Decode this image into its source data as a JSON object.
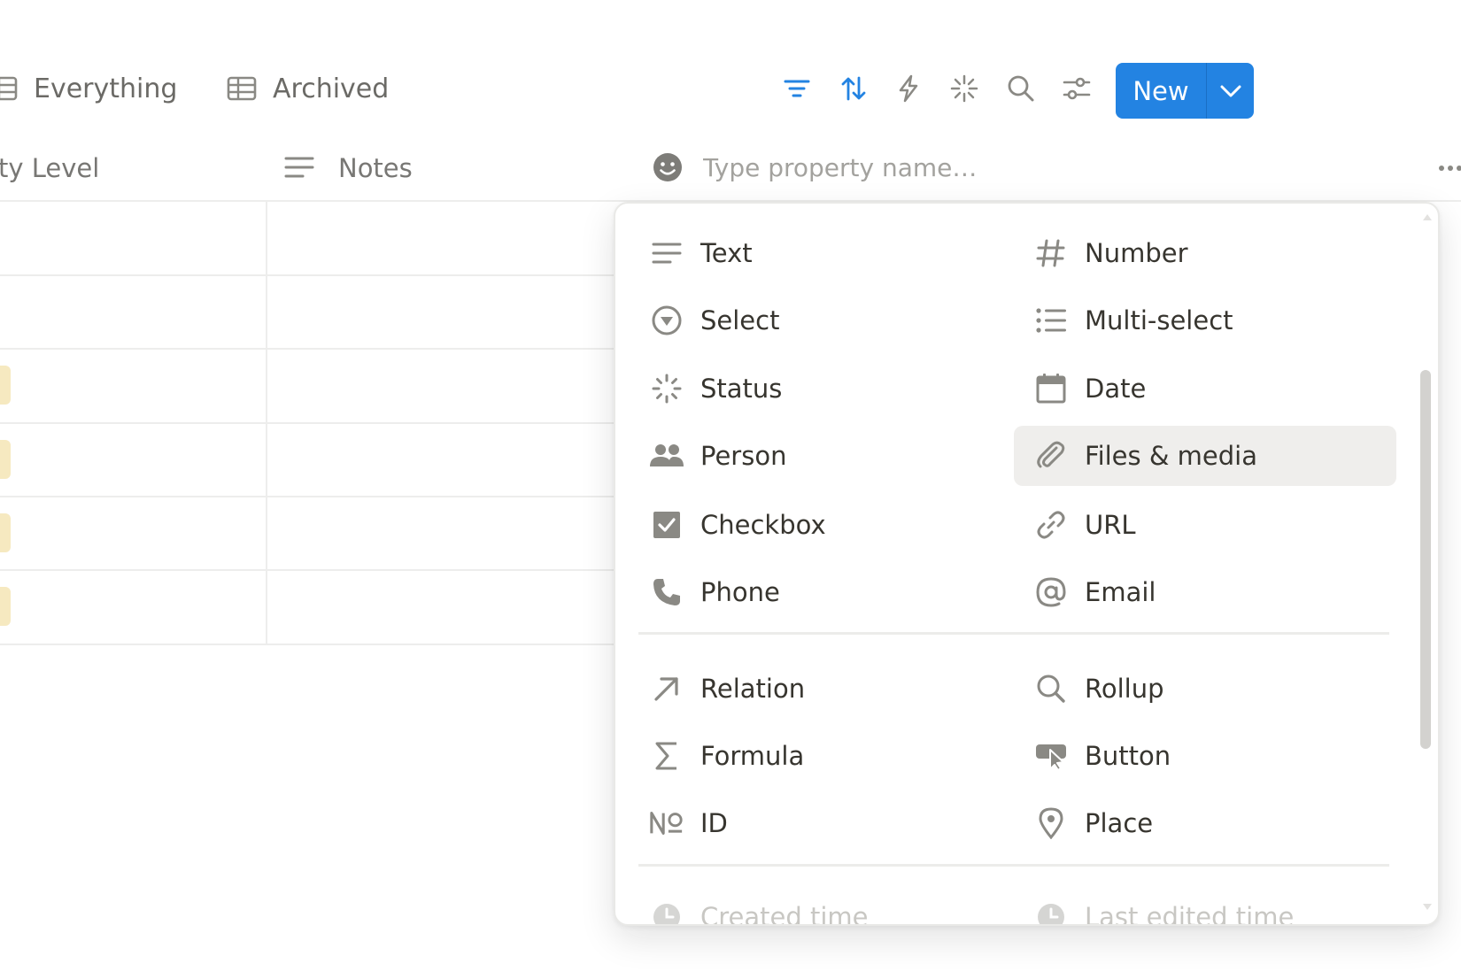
{
  "views": {
    "tabs": [
      {
        "label": "Everything",
        "icon": "table-icon"
      },
      {
        "label": "Archived",
        "icon": "table-icon"
      }
    ]
  },
  "toolbar": {
    "icons": [
      "filter-icon",
      "sort-icon",
      "automation-icon",
      "ai-sparkle-icon",
      "search-icon",
      "settings-sliders-icon"
    ],
    "accent": "#2383e2",
    "new_label": "New"
  },
  "table": {
    "columns": [
      {
        "label": "ty Level"
      },
      {
        "label": "Notes",
        "icon": "text-lines-icon"
      }
    ],
    "tag_color": "#f6e9c0"
  },
  "property_input": {
    "placeholder": "Type property name…",
    "value": "",
    "icon": "emoji-face-icon"
  },
  "property_types": {
    "basic": [
      {
        "label": "Text",
        "icon": "text-icon"
      },
      {
        "label": "Number",
        "icon": "hash-icon"
      },
      {
        "label": "Select",
        "icon": "select-circle-icon"
      },
      {
        "label": "Multi-select",
        "icon": "list-icon"
      },
      {
        "label": "Status",
        "icon": "status-spinner-icon"
      },
      {
        "label": "Date",
        "icon": "calendar-icon"
      },
      {
        "label": "Person",
        "icon": "people-icon"
      },
      {
        "label": "Files & media",
        "icon": "paperclip-icon"
      },
      {
        "label": "Checkbox",
        "icon": "checkbox-icon"
      },
      {
        "label": "URL",
        "icon": "link-icon"
      },
      {
        "label": "Phone",
        "icon": "phone-icon"
      },
      {
        "label": "Email",
        "icon": "at-icon"
      }
    ],
    "advanced": [
      {
        "label": "Relation",
        "icon": "arrow-up-right-icon"
      },
      {
        "label": "Rollup",
        "icon": "magnifier-icon"
      },
      {
        "label": "Formula",
        "icon": "sigma-icon"
      },
      {
        "label": "Button",
        "icon": "cursor-button-icon"
      },
      {
        "label": "ID",
        "icon": "numero-icon"
      },
      {
        "label": "Place",
        "icon": "pin-icon"
      }
    ],
    "meta": [
      {
        "label": "Created time",
        "icon": "clock-icon"
      },
      {
        "label": "Last edited time",
        "icon": "clock-icon"
      }
    ],
    "highlighted": "Files & media"
  }
}
